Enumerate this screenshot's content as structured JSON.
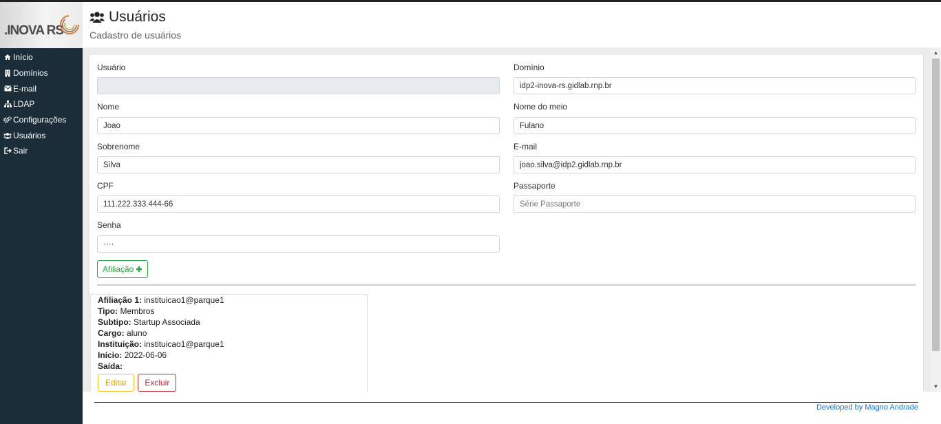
{
  "sidebar": {
    "logo_text": ".INOVA RS",
    "items": [
      {
        "label": "Início",
        "icon": "home-icon"
      },
      {
        "label": "Domínios",
        "icon": "building-icon"
      },
      {
        "label": "E-mail",
        "icon": "envelope-icon"
      },
      {
        "label": "LDAP",
        "icon": "sitemap-icon"
      },
      {
        "label": "Configurações",
        "icon": "cogs-icon"
      },
      {
        "label": "Usuários",
        "icon": "users-icon"
      },
      {
        "label": "Sair",
        "icon": "sign-out-icon"
      }
    ]
  },
  "header": {
    "title": "Usuários",
    "subtitle": "Cadastro de usuários"
  },
  "form": {
    "usuario": {
      "label": "Usuário",
      "value": ""
    },
    "dominio": {
      "label": "Domínio",
      "value": "idp2-inova-rs.gidlab.rnp.br"
    },
    "nome": {
      "label": "Nome",
      "value": "Joao"
    },
    "nome_meio": {
      "label": "Nome do meio",
      "value": "Fulano"
    },
    "sobrenome": {
      "label": "Sobrenome",
      "value": "Silva"
    },
    "email": {
      "label": "E-mail",
      "value": "joao.silva@idp2.gidlab.rnp.br"
    },
    "cpf": {
      "label": "CPF",
      "value": "111.222.333.444-66"
    },
    "passaporte": {
      "label": "Passaporte",
      "value": "",
      "placeholder": "Série Passaporte"
    },
    "senha": {
      "label": "Senha",
      "value": "····"
    },
    "afiliacao_button": "Afiliação"
  },
  "affiliation": {
    "rows": [
      {
        "key": "Afiliação 1:",
        "value": "instituicao1@parque1"
      },
      {
        "key": "Tipo:",
        "value": "Membros"
      },
      {
        "key": "Subtipo:",
        "value": "Startup Associada"
      },
      {
        "key": "Cargo:",
        "value": "aluno"
      },
      {
        "key": "Instituição:",
        "value": "instituicao1@parque1"
      },
      {
        "key": "Início:",
        "value": "2022-06-06"
      },
      {
        "key": "Saída:",
        "value": ""
      }
    ],
    "edit_label": "Editar",
    "delete_label": "Excluir"
  },
  "footer": {
    "credit": "Developed by Magno Andrade"
  },
  "colors": {
    "sidebar_bg": "#1c2d3a",
    "success": "#28a745",
    "warning": "#f0c419",
    "danger": "#c82333",
    "link": "#1a73c9"
  }
}
